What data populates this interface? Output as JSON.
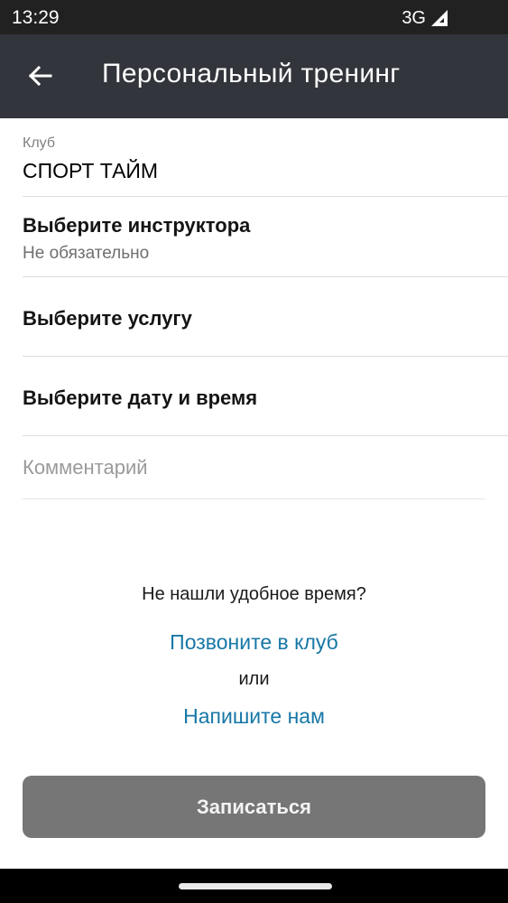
{
  "status_bar": {
    "time": "13:29",
    "network": "3G",
    "signal_icon": "signal-icon"
  },
  "app_bar": {
    "back_icon": "arrow-left-icon",
    "title": "Персональный тренинг"
  },
  "form": {
    "club": {
      "label": "Клуб",
      "value": "СПОРТ ТАЙМ"
    },
    "instructor": {
      "title": "Выберите инструктора",
      "subtitle": "Не обязательно"
    },
    "service": {
      "title": "Выберите услугу"
    },
    "datetime": {
      "title": "Выберите дату и время"
    },
    "comment": {
      "placeholder": "Комментарий",
      "value": ""
    }
  },
  "help": {
    "question": "Не нашли удобное время?",
    "call_link": "Позвоните в клуб",
    "or": "или",
    "write_link": "Напишите нам"
  },
  "submit": {
    "label": "Записаться"
  },
  "colors": {
    "app_bar": "#32353b",
    "status_bar": "#212121",
    "link": "#1877a6",
    "button": "#767676"
  }
}
